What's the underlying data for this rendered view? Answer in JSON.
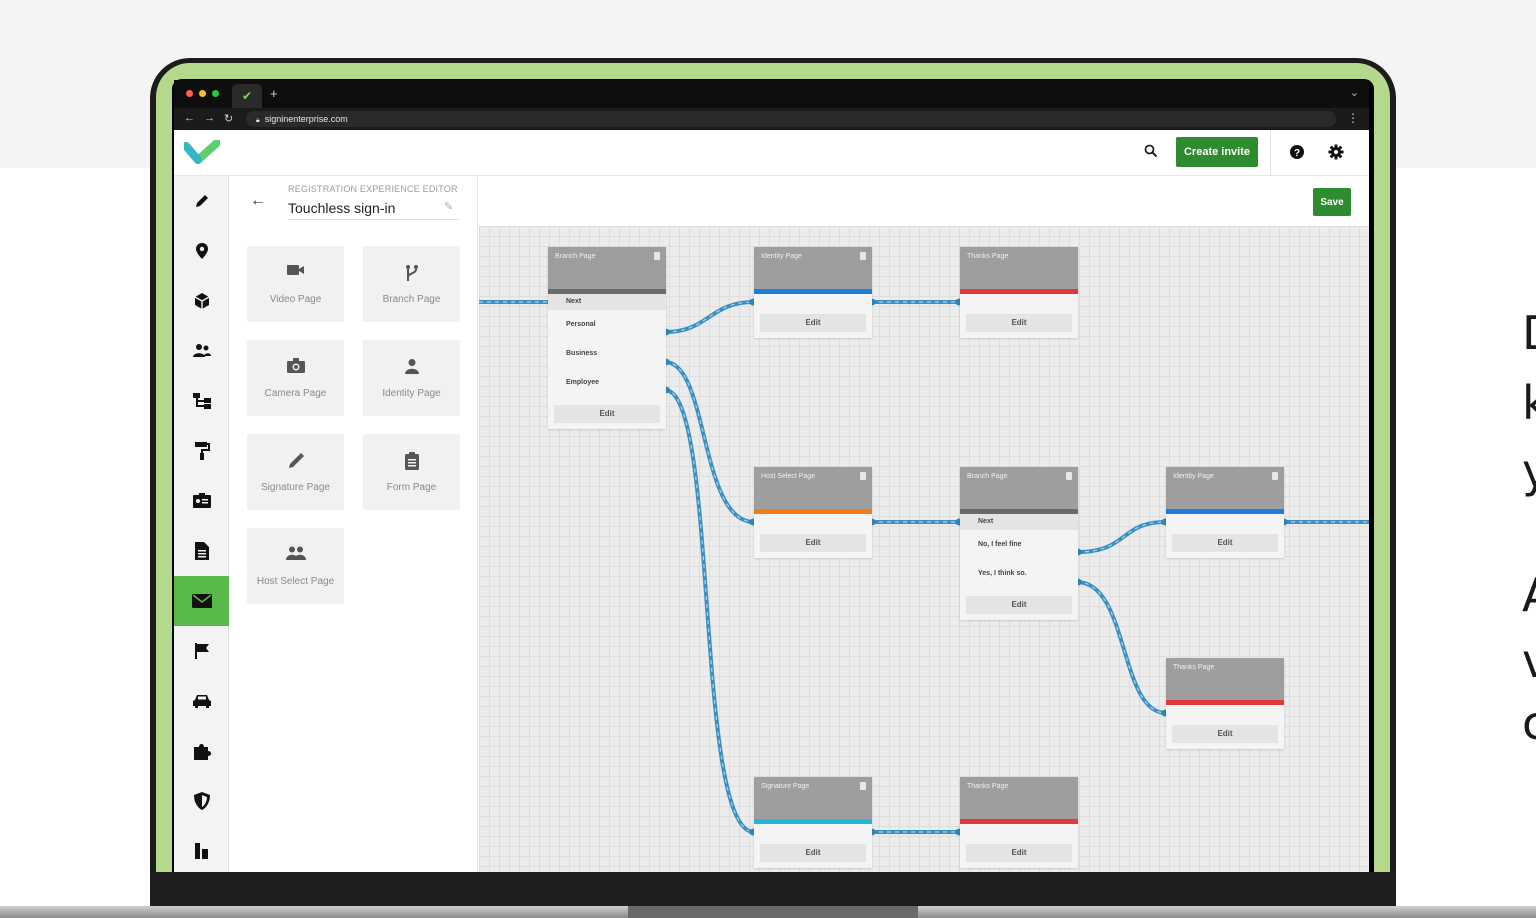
{
  "browser": {
    "url": "signinenterprise.com"
  },
  "appbar": {
    "create_invite_label": "Create invite"
  },
  "panel": {
    "subtitle": "REGISTRATION EXPERIENCE EDITOR",
    "title": "Touchless sign-in",
    "tiles": [
      "Video Page",
      "Branch Page",
      "Camera Page",
      "Identity Page",
      "Signature Page",
      "Form Page",
      "Host Select Page"
    ]
  },
  "canvas": {
    "save_label": "Save",
    "edit_label": "Edit",
    "nodes": {
      "branch1": {
        "title": "Branch Page",
        "next": "Next",
        "options": [
          "Personal",
          "Business",
          "Employee"
        ]
      },
      "identity1": {
        "title": "Identity Page"
      },
      "thanks1": {
        "title": "Thanks Page"
      },
      "host": {
        "title": "Host Select Page"
      },
      "branch2": {
        "title": "Branch Page",
        "next": "Next",
        "options": [
          "No, I feel fine",
          "Yes, I think so."
        ]
      },
      "identity2": {
        "title": "Identity Page"
      },
      "thanks2": {
        "title": "Thanks Page"
      },
      "signature": {
        "title": "Signature Page"
      },
      "thanks3": {
        "title": "Thanks Page"
      }
    }
  },
  "colors": {
    "brand_green": "#2e8b2e",
    "nav_active": "#57b947",
    "link_blue": "#3a8fc0",
    "bar_identity": "#1e7fd6",
    "bar_thanks": "#e0383b",
    "bar_host": "#f07d1a",
    "bar_signature": "#22b7d6",
    "bar_branch": "#6a6a6a"
  },
  "side_text": [
    "D",
    "k",
    "y",
    "A",
    "v",
    "c"
  ]
}
